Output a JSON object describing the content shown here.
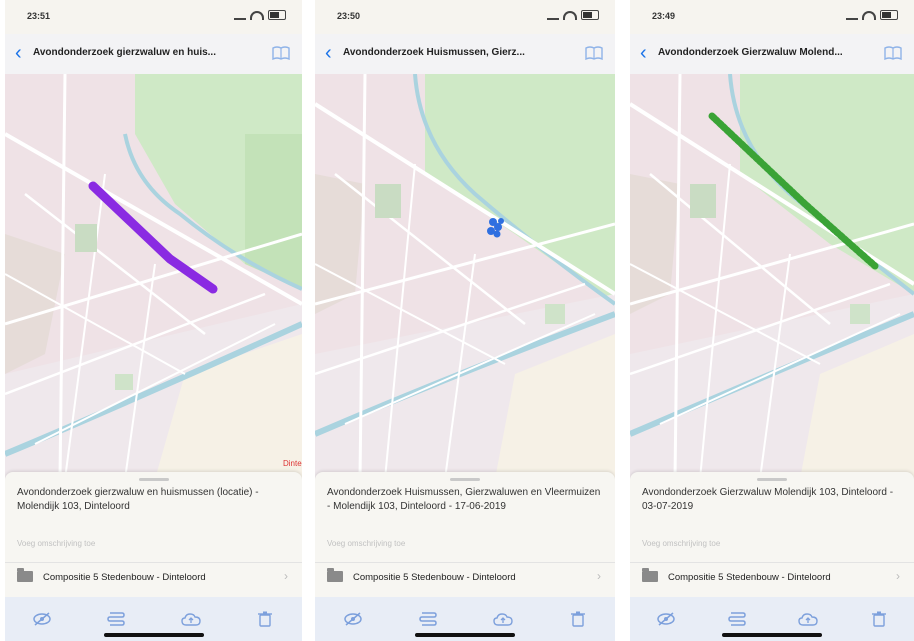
{
  "colors": {
    "accent": "#1b73e8",
    "route_purple": "#8a2be2",
    "route_blue": "#2f6fe0",
    "route_green": "#3aa336",
    "park": "#cfe9c6",
    "urban": "#efe2e6",
    "water": "#aad3df"
  },
  "screens": [
    {
      "status_time": "23:51",
      "nav_title": "Avondonderzoek gierzwaluw en huis...",
      "description": "Avondonderzoek gierzwaluw en huismussen (locatie) - Molendijk 103, Dinteloord",
      "description_placeholder": "Voeg omschrijving toe",
      "folder_name": "Compositie 5 Stedenbouw - Dinteloord",
      "route_color": "route_purple",
      "map_label": "Dintel"
    },
    {
      "status_time": "23:50",
      "nav_title": "Avondonderzoek Huismussen, Gierz...",
      "description": "Avondonderzoek Huismussen, Gierzwaluwen en Vleermuizen - Molendijk 103, Dinteloord - 17-06-2019",
      "description_placeholder": "Voeg omschrijving toe",
      "folder_name": "Compositie 5 Stedenbouw - Dinteloord",
      "route_color": "route_blue",
      "map_label": ""
    },
    {
      "status_time": "23:49",
      "nav_title": "Avondonderzoek Gierzwaluw Molend...",
      "description": "Avondonderzoek Gierzwaluw Molendijk 103, Dinteloord - 03-07-2019",
      "description_placeholder": "Voeg omschrijving toe",
      "folder_name": "Compositie 5 Stedenbouw - Dinteloord",
      "route_color": "route_green",
      "map_label": ""
    }
  ],
  "toolbar_icons": [
    "eye-slash-icon",
    "route-icon",
    "cloud-upload-icon",
    "trash-icon"
  ]
}
